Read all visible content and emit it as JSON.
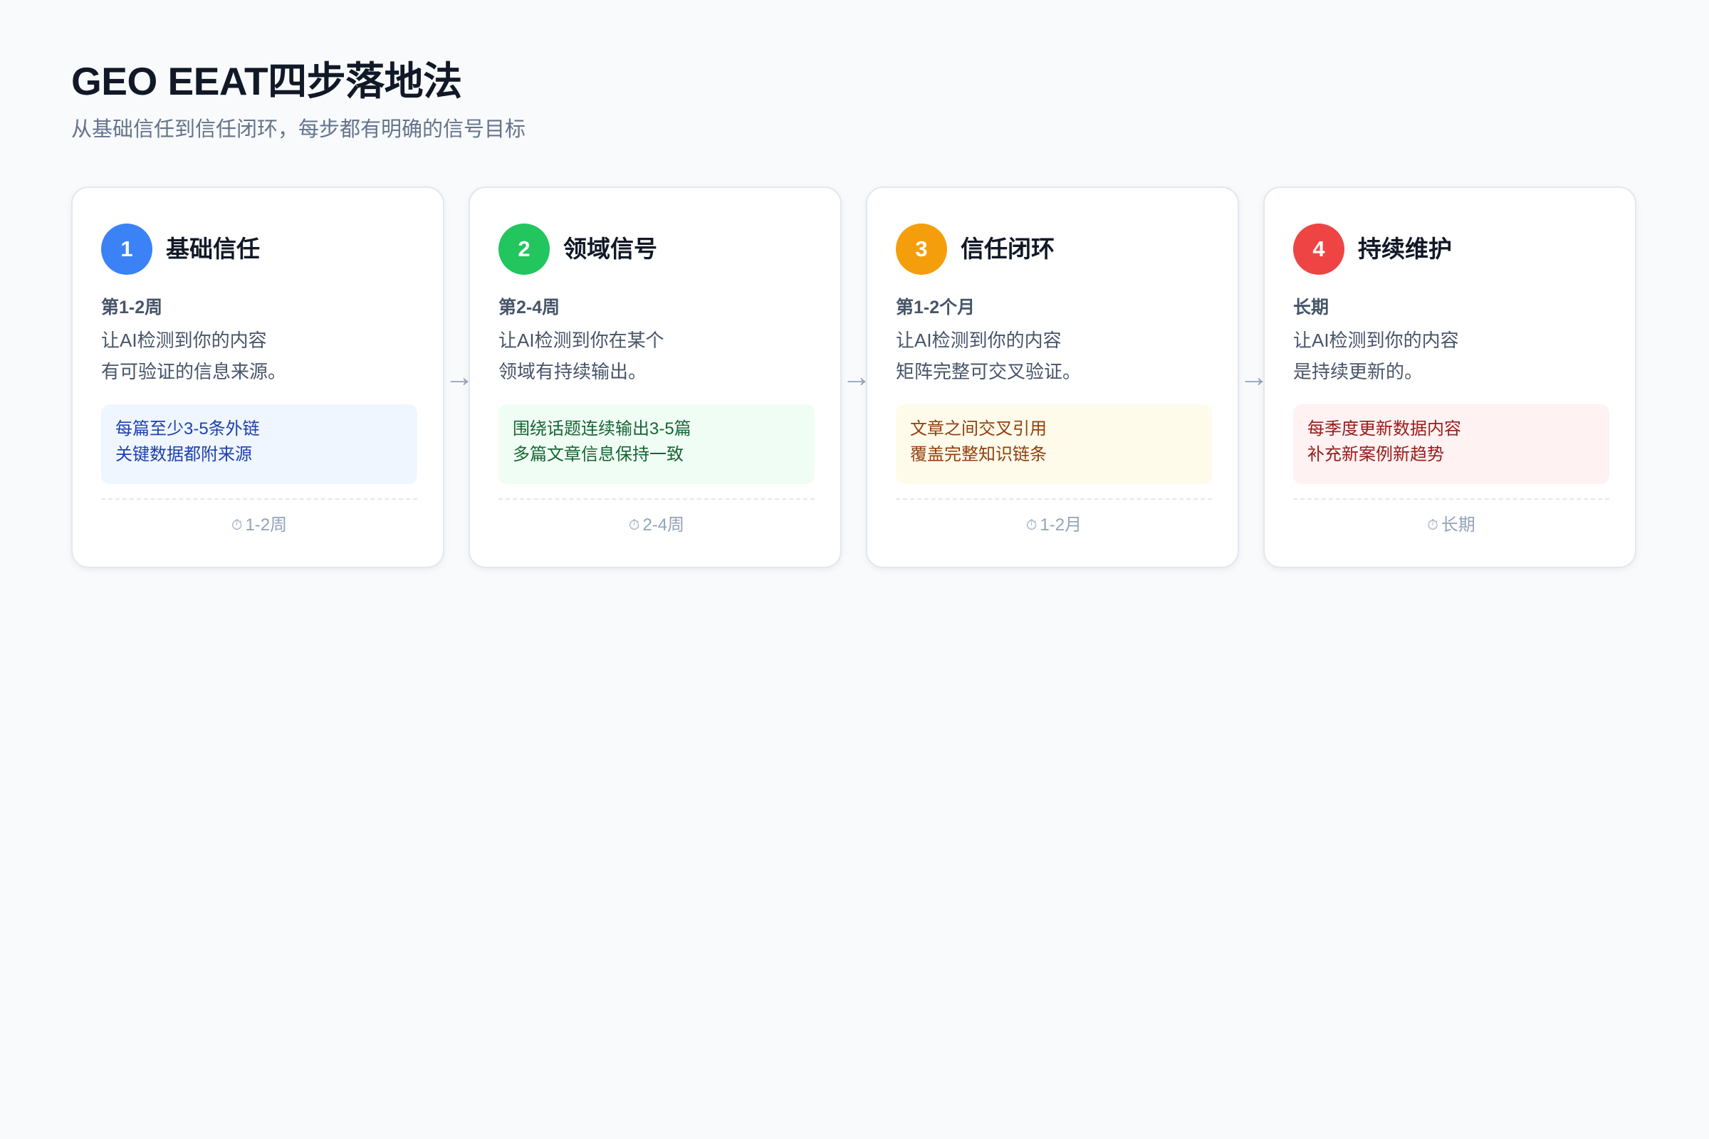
{
  "header": {
    "title": "GEO EEAT四步落地法",
    "subtitle": "从基础信任到信任闭环，每步都有明确的信号目标"
  },
  "colors": {
    "page_background": "#f8fafc",
    "step_1": "#3b82f6",
    "step_2": "#22c55e",
    "step_3": "#f59e0b",
    "step_4": "#ef4444"
  },
  "arrows": {
    "glyph": "→"
  },
  "steps": [
    {
      "number": "1",
      "title": "基础信任",
      "period": "第1-2周",
      "description": [
        "让AI检测到你的内容",
        "有可验证的信息来源。"
      ],
      "details": [
        "每篇至少3-5条外链",
        "关键数据都附来源"
      ],
      "duration_icon": "clock-icon",
      "duration_glyph": "⏱",
      "duration": "1-2周"
    },
    {
      "number": "2",
      "title": "领域信号",
      "period": "第2-4周",
      "description": [
        "让AI检测到你在某个",
        "领域有持续输出。"
      ],
      "details": [
        "围绕话题连续输出3-5篇",
        "多篇文章信息保持一致"
      ],
      "duration_icon": "clock-icon",
      "duration_glyph": "⏱",
      "duration": "2-4周"
    },
    {
      "number": "3",
      "title": "信任闭环",
      "period": "第1-2个月",
      "description": [
        "让AI检测到你的内容",
        "矩阵完整可交叉验证。"
      ],
      "details": [
        "文章之间交叉引用",
        "覆盖完整知识链条"
      ],
      "duration_icon": "clock-icon",
      "duration_glyph": "⏱",
      "duration": "1-2月"
    },
    {
      "number": "4",
      "title": "持续维护",
      "period": "长期",
      "description": [
        "让AI检测到你的内容",
        "是持续更新的。"
      ],
      "details": [
        "每季度更新数据内容",
        "补充新案例新趋势"
      ],
      "duration_icon": "clock-icon",
      "duration_glyph": "⏱",
      "duration": "长期"
    }
  ]
}
